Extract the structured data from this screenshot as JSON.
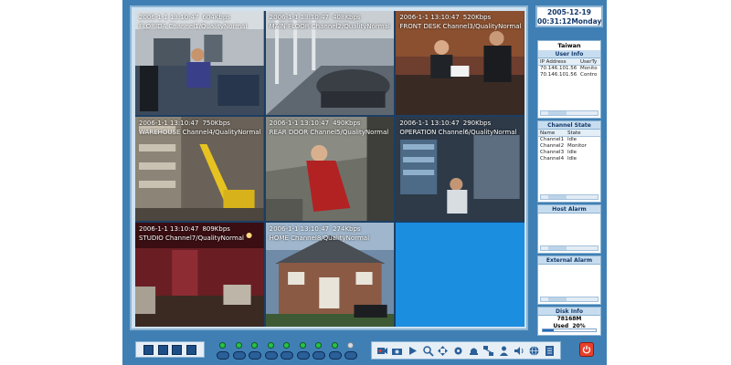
{
  "clock": {
    "date": "2005-12-19",
    "time": "00:31:12",
    "weekday": "Monday"
  },
  "channels": [
    {
      "timestamp": "2006-1-1 13:10:47",
      "bitrate": "604Kbps",
      "caption": "FLORIDA  Channel1/QualityNormal"
    },
    {
      "timestamp": "2006-1-1 13:10:47",
      "bitrate": "408Kbps",
      "caption": "MAIN FLOOR  Channel2/QualityNormal"
    },
    {
      "timestamp": "2006-1-1 13:10:47",
      "bitrate": "520Kbps",
      "caption": "FRONT DESK  Channel3/QualityNormal"
    },
    {
      "timestamp": "2006-1-1 13:10:47",
      "bitrate": "750Kbps",
      "caption": "WAREHOUSE  Channel4/QualityNormal"
    },
    {
      "timestamp": "2006-1-1 13:10:47",
      "bitrate": "490Kbps",
      "caption": "REAR DOOR  Channel5/QualityNormal"
    },
    {
      "timestamp": "2006-1-1 13:10:47",
      "bitrate": "290Kbps",
      "caption": "OPERATION  Channel6/QualityNormal"
    },
    {
      "timestamp": "2006-1-1 13:10:47",
      "bitrate": "809Kbps",
      "caption": "STUDIO  Channel7/QualityNormal"
    },
    {
      "timestamp": "2006-1-1 13:10:47",
      "bitrate": "274Kbps",
      "caption": "HOME  Channel8/QualityNormal"
    }
  ],
  "server": {
    "name": "Taiwan"
  },
  "user_info": {
    "title": "User Info",
    "columns": [
      "IP Address",
      "UserTy"
    ],
    "rows": [
      [
        "70.146.101.56",
        "Monito"
      ],
      [
        "70.146.101.56",
        "Contro"
      ]
    ]
  },
  "channel_state": {
    "title": "Channel State",
    "columns": [
      "Name",
      "State"
    ],
    "rows": [
      [
        "Channel1",
        "Idle"
      ],
      [
        "Channel2",
        "Monitor"
      ],
      [
        "Channel3",
        "Idle"
      ],
      [
        "Channel4",
        "Idle"
      ]
    ]
  },
  "host_alarm": {
    "title": "Host Alarm"
  },
  "external_alarm": {
    "title": "External Alarm"
  },
  "disk_info": {
    "title": "Disk Info",
    "free": "78168M",
    "used_label": "Used",
    "used_percent": "20%",
    "used_fraction": 0.2
  },
  "toolbar": {
    "layouts": [
      "layout-1x1",
      "layout-2x2",
      "layout-3x3",
      "layout-4x4"
    ],
    "channel_leds": [
      true,
      true,
      true,
      true,
      true,
      true,
      true,
      true,
      false
    ],
    "tools": [
      "record-icon",
      "snapshot-icon",
      "playback-icon",
      "search-icon",
      "ptz-icon",
      "config-icon",
      "alarm-icon",
      "network-icon",
      "user-icon",
      "sound-icon",
      "globe-icon",
      "log-icon"
    ]
  },
  "colors": {
    "accent": "#3f7fb4",
    "panel_header": "#c7ddef",
    "empty_cell": "#1c8ee0",
    "power": "#e8402b"
  }
}
